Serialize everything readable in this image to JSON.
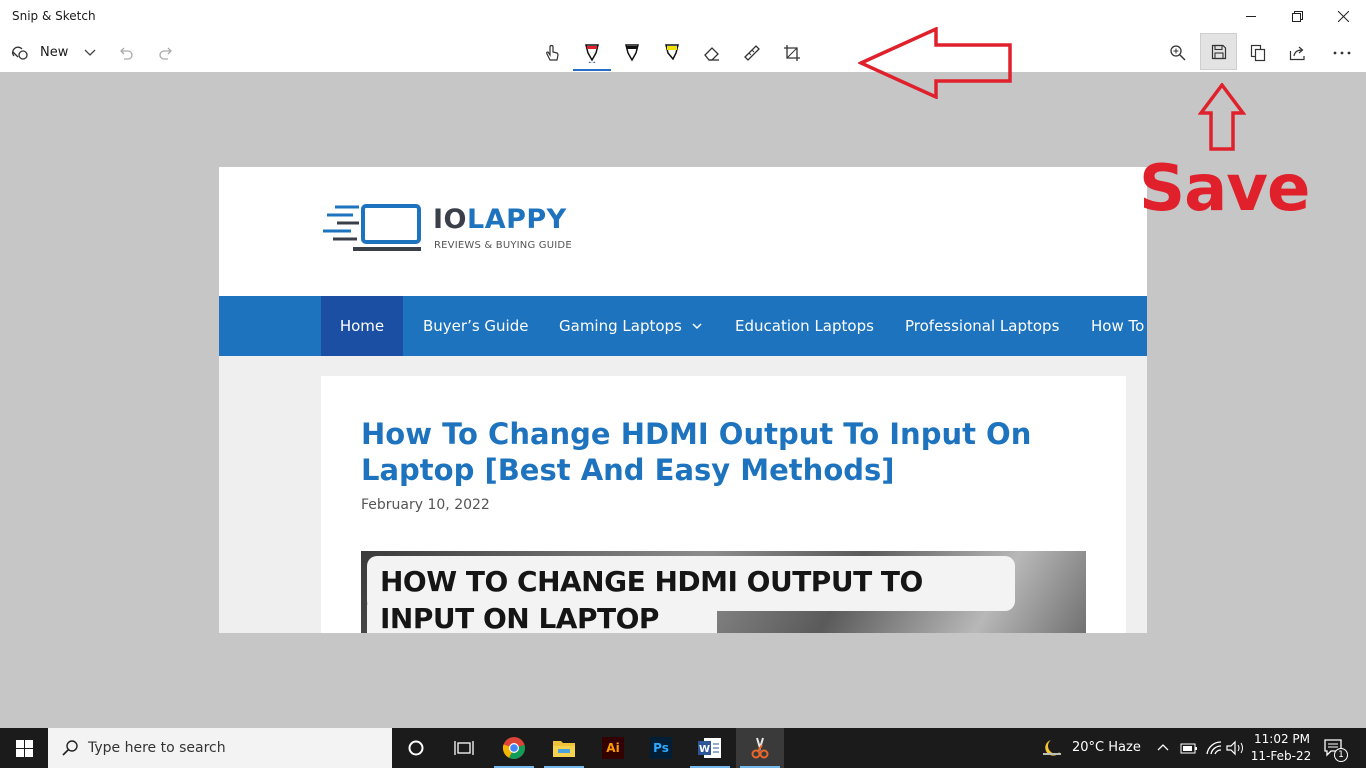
{
  "window": {
    "title": "Snip & Sketch",
    "controls": {
      "minimize": "minimize-icon",
      "restore": "restore-icon",
      "close": "close-icon"
    }
  },
  "toolbar": {
    "new_label": "New",
    "left_icons": [
      "new-snip-icon",
      "chevron-down-icon",
      "undo-icon",
      "redo-icon"
    ],
    "center_tools": [
      "touch-writing-icon",
      "ballpoint-pen-icon",
      "pencil-icon",
      "highlighter-icon",
      "eraser-icon",
      "ruler-icon",
      "crop-icon"
    ],
    "selected_tool": "ballpoint-pen-icon",
    "right_icons": [
      "zoom-icon",
      "save-icon",
      "copy-icon",
      "share-icon",
      "more-icon"
    ]
  },
  "annotations": {
    "save_text": "Save",
    "color": "#e0212b"
  },
  "capture": {
    "logo": {
      "word_part1": "IO",
      "word_part2": "LAPPY",
      "tagline": "REVIEWS & BUYING GUIDE"
    },
    "nav": [
      "Home",
      "Buyer’s Guide",
      "Gaming Laptops",
      "Education Laptops",
      "Professional Laptops",
      "How To"
    ],
    "post": {
      "title": "How To Change HDMI Output To Input On Laptop [Best And Easy Methods]",
      "date": "February 10, 2022",
      "image_line1": "HOW TO CHANGE HDMI OUTPUT TO",
      "image_line2": "INPUT ON LAPTOP"
    },
    "colors": {
      "brand_blue": "#1e73be",
      "nav_active": "#1b4fa3",
      "logo_dark": "#3a3f4a"
    }
  },
  "taskbar": {
    "search_placeholder": "Type here to search",
    "pinned": [
      "windows-start-icon",
      "cortana-icon",
      "task-view-icon",
      "chrome-icon",
      "file-explorer-icon",
      "illustrator-icon",
      "photoshop-icon",
      "word-icon",
      "snip-sketch-icon"
    ],
    "illustrator_label": "Ai",
    "photoshop_label": "Ps",
    "weather": "20°C  Haze",
    "time": "11:02 PM",
    "date": "11-Feb-22",
    "notification_count": "1"
  }
}
